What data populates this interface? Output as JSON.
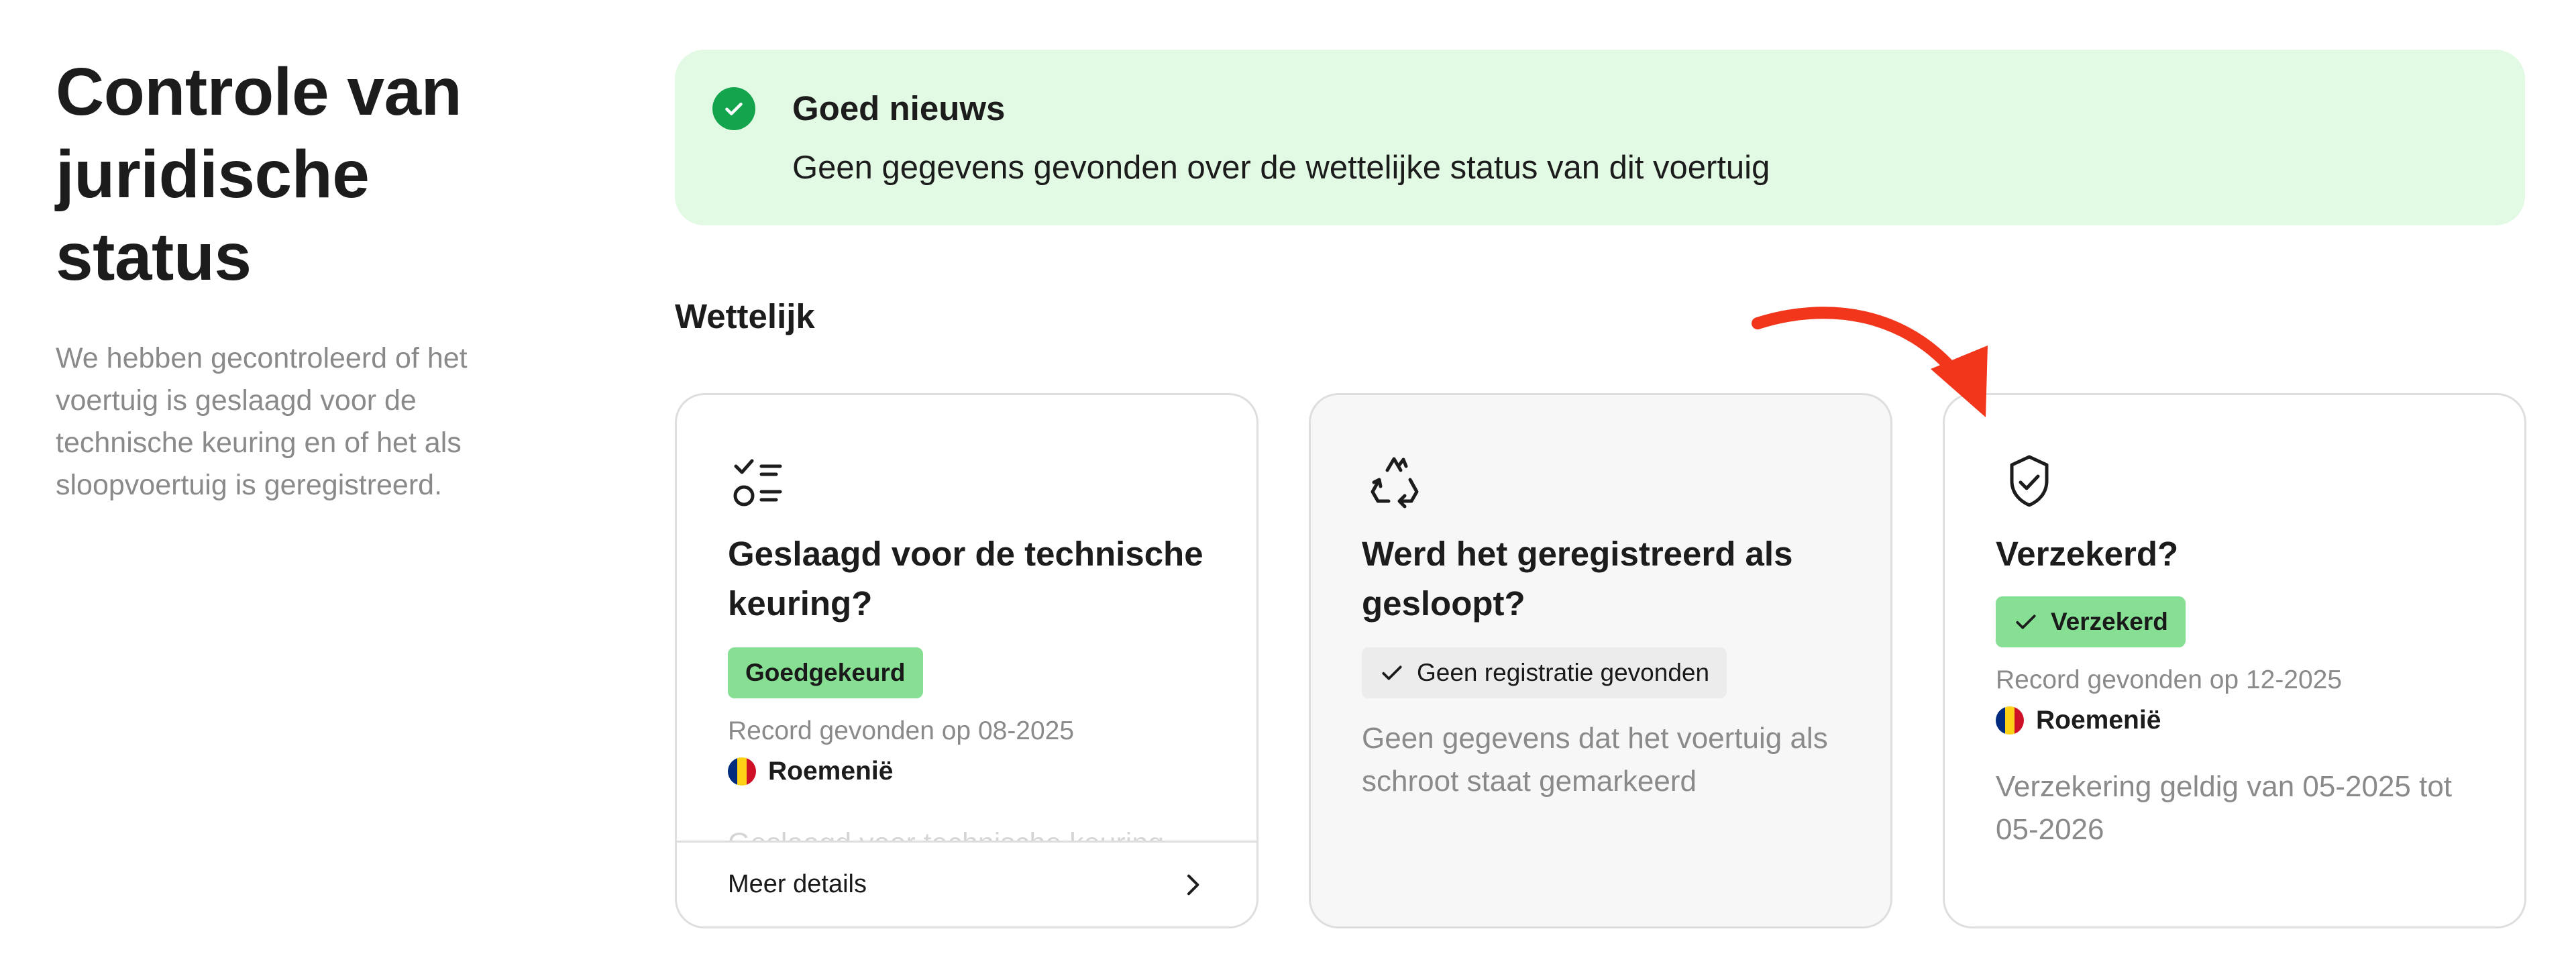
{
  "intro": {
    "title": "Controle van juridische status",
    "description": "We hebben gecontroleerd of het voertuig is geslaagd voor de technische keuring en of het als sloopvoertuig is geregistreerd."
  },
  "banner": {
    "icon": "check-circle-icon",
    "title": "Goed nieuws",
    "text": "Geen gegevens gevonden over de wettelijke status van dit voertuig"
  },
  "section": {
    "title": "Wettelijk"
  },
  "cards": [
    {
      "icon": "checklist-icon",
      "title": "Geslaagd voor de technische keuring?",
      "badge": "Goedgekeurd",
      "record": "Record gevonden op 08-2025",
      "country": "Roemenië",
      "faded_text": "Geslaagd voor technische keuring",
      "details_label": "Meer details"
    },
    {
      "icon": "recycle-icon",
      "title": "Werd het geregistreerd als gesloopt?",
      "badge": "Geen registratie gevonden",
      "text": "Geen gegevens dat het voertuig als schroot staat gemarkeerd"
    },
    {
      "icon": "shield-check-icon",
      "title": "Verzekerd?",
      "badge": "Verzekerd",
      "record": "Record gevonden op 12-2025",
      "country": "Roemenië",
      "text": "Verzekering geldig van 05-2025 tot 05-2026"
    }
  ],
  "colors": {
    "banner_bg": "#e2fae4",
    "success": "#14a44d",
    "badge_green": "#86df93",
    "annotation_arrow": "#f2361c"
  }
}
